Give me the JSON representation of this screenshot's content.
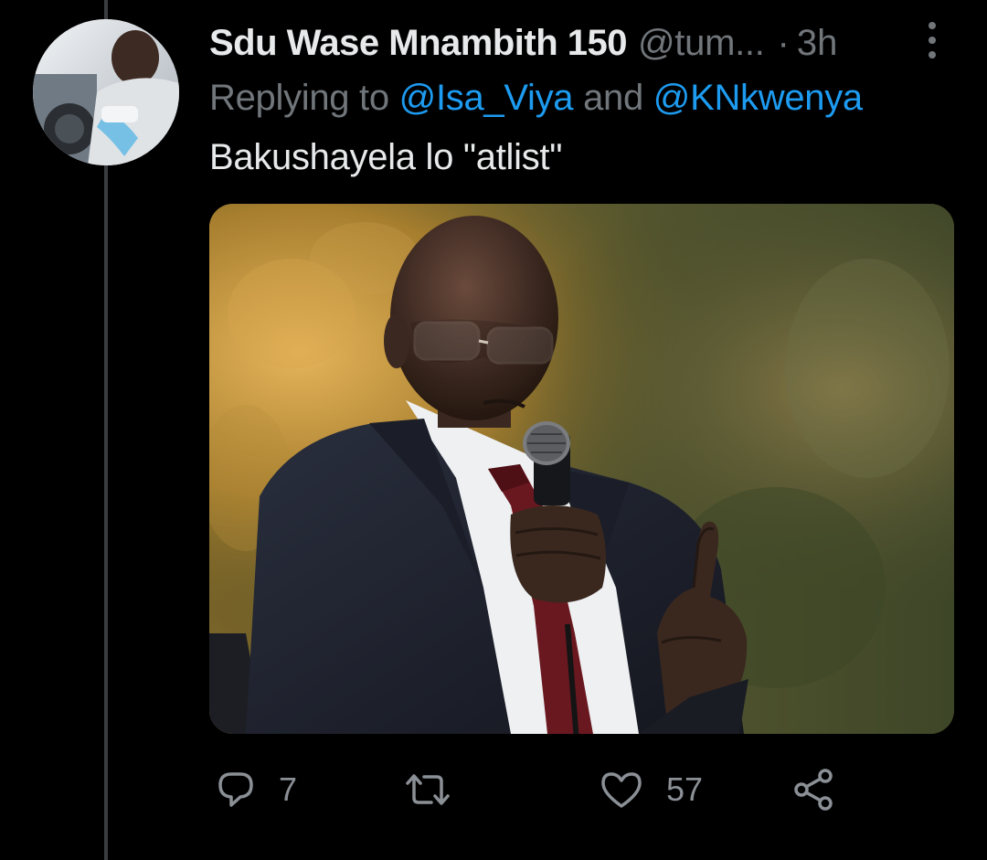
{
  "tweet": {
    "display_name": "Sdu Wase Mnambith 150",
    "handle": "@tum...",
    "separator": "·",
    "timestamp": "3h",
    "replying_prefix": "Replying to",
    "reply_mentions": [
      "@Isa_Viya",
      "@KNkwenya"
    ],
    "reply_joiner": "and",
    "text": "Bakushayela lo \"atlist\"",
    "media": {
      "type": "photo"
    },
    "actions": {
      "reply_count": "7",
      "retweet_count": "",
      "like_count": "57"
    },
    "icons": {
      "more": "more-vertical-icon",
      "reply": "reply-icon",
      "retweet": "retweet-icon",
      "like": "heart-icon",
      "share": "share-icon"
    }
  },
  "colors": {
    "background": "#000000",
    "primary_text": "#e7e9ea",
    "secondary_text": "#71767b",
    "mention": "#1d9bf0",
    "thread_line": "#3a3d40"
  }
}
